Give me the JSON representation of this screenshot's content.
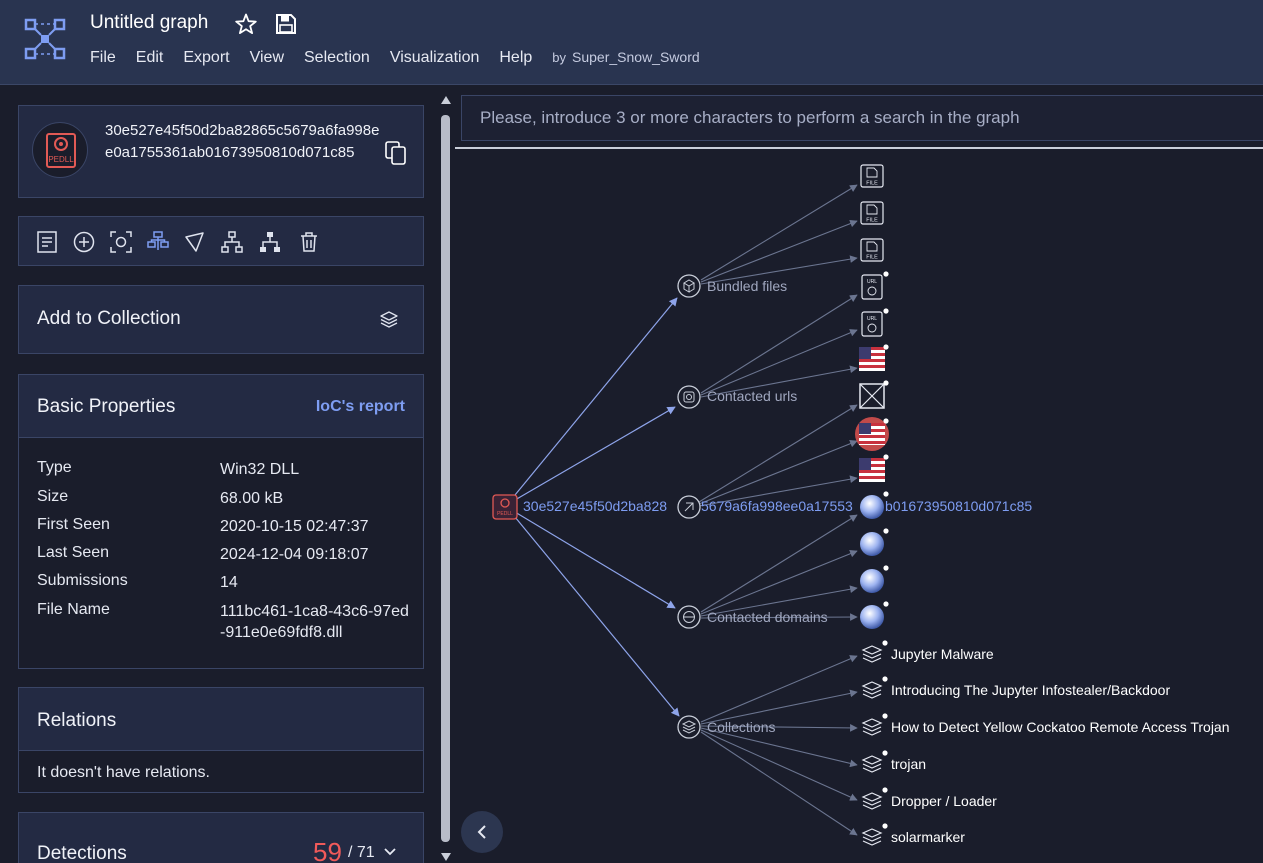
{
  "header": {
    "title": "Untitled graph",
    "menu": [
      "File",
      "Edit",
      "Export",
      "View",
      "Selection",
      "Visualization",
      "Help"
    ],
    "by_label": "by",
    "user": "Super_Snow_Sword",
    "icons": [
      "graph-logo-icon",
      "star-icon",
      "save-icon"
    ]
  },
  "node_card": {
    "hash": "30e527e45f50d2ba82865c5679a6fa998ee0a1755361ab01673950810d071c85",
    "avatar_label": "PEDLL",
    "copy_icon": "copy-icon"
  },
  "toolbar": {
    "tools": [
      "notes-icon",
      "add-node-icon",
      "focus-icon",
      "expand-relations-icon",
      "highlight-icon",
      "hierarchy-icon",
      "hierarchy-filled-icon",
      "trash-icon"
    ]
  },
  "collection": {
    "label": "Add to Collection",
    "icon": "collection-icon"
  },
  "basic_properties": {
    "title": "Basic Properties",
    "ioc_link": "IoC's report",
    "rows": [
      {
        "key": "Type",
        "value": "Win32 DLL"
      },
      {
        "key": "Size",
        "value": "68.00 kB"
      },
      {
        "key": "First Seen",
        "value": "2020-10-15 02:47:37"
      },
      {
        "key": "Last Seen",
        "value": "2024-12-04 09:18:07"
      },
      {
        "key": "Submissions",
        "value": "14"
      },
      {
        "key": "File Name",
        "value": "111bc461-1ca8-43c6-97ed-911e0e69fdf8.dll"
      }
    ]
  },
  "relations": {
    "title": "Relations",
    "empty_text": "It doesn't have relations."
  },
  "detections": {
    "title": "Detections",
    "count": "59",
    "total": "/ 71"
  },
  "search": {
    "placeholder": "Please, introduce 3 or more characters to perform a search in the graph"
  },
  "graph": {
    "root_label": "30e527e45f50d2ba828",
    "overlap_label": "5679a6fa998ee0a17553",
    "overlap_label_end": "b01673950810d071c85",
    "groups": [
      {
        "label": "Bundled files",
        "icon": "bundle-icon"
      },
      {
        "label": "Contacted urls",
        "icon": "url-icon"
      },
      {
        "label": "Contacted domains",
        "icon": "domain-icon"
      },
      {
        "label": "Collections",
        "icon": "collection-icon"
      }
    ],
    "file_node_label": "FILE",
    "url_node_label": "URL",
    "collections": [
      "Jupyter Malware",
      "Introducing The Jupyter Infostealer/Backdoor",
      "How to Detect Yellow Cockatoo Remote Access Trojan",
      "trojan",
      "Dropper / Loader",
      "solarmarker"
    ],
    "colors": {
      "edge": "#6b7590",
      "edge_highlight": "#8ea4ea",
      "label_dim": "#a0a7bf",
      "root_label": "#7e9df2"
    }
  }
}
